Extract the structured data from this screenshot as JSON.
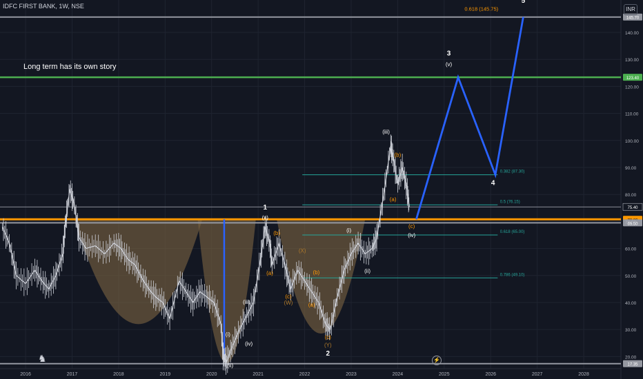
{
  "header": {
    "symbol": "IDFC FIRST BANK, 1W, NSE",
    "currency": "INR"
  },
  "icons": {
    "tv_logo": "tradingview-logo-icon",
    "lightning": "lightning-icon"
  },
  "chart_data": {
    "type": "line",
    "xlim": [
      2015.45,
      2028.8
    ],
    "ylim": [
      15.5,
      152
    ],
    "x_ticks": [
      "2016",
      "2017",
      "2018",
      "2019",
      "2020",
      "2021",
      "2022",
      "2023",
      "2024",
      "2025",
      "2026",
      "2027",
      "2028"
    ],
    "y_ticks": [
      20,
      30,
      40,
      50,
      60,
      70,
      80,
      90,
      100,
      110,
      120,
      130,
      140
    ],
    "annotation_text": "Long term has its own story",
    "horizontal_levels": [
      {
        "price": 145.7,
        "label": "145.70",
        "color": "#9598a1"
      },
      {
        "price": 123.4,
        "label": "123.40",
        "color": "#4caf50"
      },
      {
        "price": 70.8,
        "label": "70.80",
        "color": "#ff9800"
      },
      {
        "price": 69.5,
        "label": "69.50",
        "color": "#9598a1"
      },
      {
        "price": 17.35,
        "label": "17.35",
        "color": "#9598a1"
      }
    ],
    "last_price": {
      "price": 75.4,
      "label": "75.40"
    },
    "fib_levels": [
      {
        "price": 87.3,
        "label": "0.382 (87.30)"
      },
      {
        "price": 76.15,
        "label": "0.5 (76.15)"
      },
      {
        "price": 65.0,
        "label": "0.618 (65.00)"
      },
      {
        "price": 49.1,
        "label": "0.786 (49.10)"
      }
    ],
    "fib_target": {
      "label": "0.618 (145.75)"
    },
    "projection": [
      [
        2024.4,
        70.8
      ],
      [
        2025.3,
        123.4
      ],
      [
        2026.1,
        87.3
      ],
      [
        2026.7,
        145.7
      ]
    ],
    "price_series": [
      [
        2015.5,
        68
      ],
      [
        2015.65,
        62
      ],
      [
        2015.8,
        50
      ],
      [
        2016.0,
        47
      ],
      [
        2016.2,
        52
      ],
      [
        2016.35,
        48
      ],
      [
        2016.5,
        45
      ],
      [
        2016.65,
        50
      ],
      [
        2016.8,
        58
      ],
      [
        2016.85,
        68
      ],
      [
        2016.95,
        82
      ],
      [
        2017.05,
        76
      ],
      [
        2017.15,
        64
      ],
      [
        2017.3,
        60
      ],
      [
        2017.5,
        61
      ],
      [
        2017.7,
        58
      ],
      [
        2017.9,
        62
      ],
      [
        2018.05,
        60
      ],
      [
        2018.2,
        56
      ],
      [
        2018.35,
        54
      ],
      [
        2018.5,
        49
      ],
      [
        2018.65,
        45
      ],
      [
        2018.8,
        42
      ],
      [
        2018.95,
        40
      ],
      [
        2019.1,
        34
      ],
      [
        2019.3,
        48
      ],
      [
        2019.45,
        44
      ],
      [
        2019.6,
        40
      ],
      [
        2019.75,
        44
      ],
      [
        2019.9,
        42
      ],
      [
        2020.05,
        40
      ],
      [
        2020.2,
        32
      ],
      [
        2020.25,
        20
      ],
      [
        2020.32,
        18
      ],
      [
        2020.45,
        24
      ],
      [
        2020.6,
        30
      ],
      [
        2020.75,
        35
      ],
      [
        2020.9,
        40
      ],
      [
        2021.05,
        56
      ],
      [
        2021.15,
        68
      ],
      [
        2021.25,
        62
      ],
      [
        2021.3,
        54
      ],
      [
        2021.45,
        62
      ],
      [
        2021.6,
        52
      ],
      [
        2021.7,
        45
      ],
      [
        2021.85,
        52
      ],
      [
        2022.0,
        48
      ],
      [
        2022.15,
        44
      ],
      [
        2022.3,
        40
      ],
      [
        2022.45,
        32
      ],
      [
        2022.55,
        30
      ],
      [
        2022.7,
        42
      ],
      [
        2022.85,
        52
      ],
      [
        2023.0,
        58
      ],
      [
        2023.15,
        62
      ],
      [
        2023.3,
        58
      ],
      [
        2023.45,
        60
      ],
      [
        2023.55,
        64
      ],
      [
        2023.7,
        80
      ],
      [
        2023.85,
        98
      ],
      [
        2023.9,
        94
      ],
      [
        2024.0,
        84
      ],
      [
        2024.1,
        90
      ],
      [
        2024.2,
        82
      ],
      [
        2024.25,
        75.4
      ]
    ],
    "arcs": [
      {
        "x0": 2017.05,
        "x1": 2019.8,
        "top": 70.8,
        "bottom": 32
      },
      {
        "x0": 2019.7,
        "x1": 2020.95,
        "top": 70.8,
        "bottom": 17.5
      },
      {
        "x0": 2021.4,
        "x1": 2023.3,
        "top": 70.8,
        "bottom": 28.5
      }
    ],
    "wave_labels": [
      {
        "text": "1",
        "x": 2021.15,
        "y": 74.5,
        "color": "#ffffff"
      },
      {
        "text": "(v)",
        "x": 2021.15,
        "y": 70.8,
        "color": "#ffffff"
      },
      {
        "text": "(b)",
        "x": 2021.4,
        "y": 65,
        "color": "#ff9800"
      },
      {
        "text": "(a)",
        "x": 2021.25,
        "y": 50.2,
        "color": "#ff9800"
      },
      {
        "text": "(X)",
        "x": 2021.95,
        "y": 58.5,
        "color": "#b07a2a"
      },
      {
        "text": "(c)",
        "x": 2021.65,
        "y": 41.5,
        "color": "#ff9800"
      },
      {
        "text": "(W)",
        "x": 2021.65,
        "y": 39.2,
        "color": "#b07a2a"
      },
      {
        "text": "(b)",
        "x": 2022.25,
        "y": 50.5,
        "color": "#ff9800"
      },
      {
        "text": "(a)",
        "x": 2022.15,
        "y": 38.5,
        "color": "#ff9800"
      },
      {
        "text": "(c)",
        "x": 2022.5,
        "y": 26.5,
        "color": "#ff9800"
      },
      {
        "text": "(Y)",
        "x": 2022.5,
        "y": 23.5,
        "color": "#b07a2a"
      },
      {
        "text": "2",
        "x": 2022.5,
        "y": 20.3,
        "color": "#ffffff"
      },
      {
        "text": "(i)",
        "x": 2020.35,
        "y": 27.5,
        "color": "#ffffff"
      },
      {
        "text": "(ii)",
        "x": 2020.4,
        "y": 16,
        "color": "#ffffff"
      },
      {
        "text": "(iii)",
        "x": 2020.75,
        "y": 39.5,
        "color": "#ffffff"
      },
      {
        "text": "(iv)",
        "x": 2020.8,
        "y": 24,
        "color": "#ffffff"
      },
      {
        "text": "(i)",
        "x": 2022.95,
        "y": 66,
        "color": "#ffffff"
      },
      {
        "text": "(ii)",
        "x": 2023.35,
        "y": 51,
        "color": "#ffffff"
      },
      {
        "text": "(iii)",
        "x": 2023.75,
        "y": 102.5,
        "color": "#ffffff"
      },
      {
        "text": "(b)",
        "x": 2024.0,
        "y": 94,
        "color": "#ff9800"
      },
      {
        "text": "(a)",
        "x": 2023.9,
        "y": 77.5,
        "color": "#ff9800"
      },
      {
        "text": "(c)",
        "x": 2024.3,
        "y": 67.5,
        "color": "#ff9800"
      },
      {
        "text": "(iv)",
        "x": 2024.3,
        "y": 64.2,
        "color": "#ffffff"
      },
      {
        "text": "3",
        "x": 2025.1,
        "y": 131.5,
        "color": "#ffffff"
      },
      {
        "text": "(v)",
        "x": 2025.1,
        "y": 127.5,
        "color": "#ffffff"
      },
      {
        "text": "4",
        "x": 2026.05,
        "y": 83.5,
        "color": "#ffffff"
      },
      {
        "text": "5",
        "x": 2026.7,
        "y": 151,
        "color": "#ffffff"
      }
    ]
  }
}
